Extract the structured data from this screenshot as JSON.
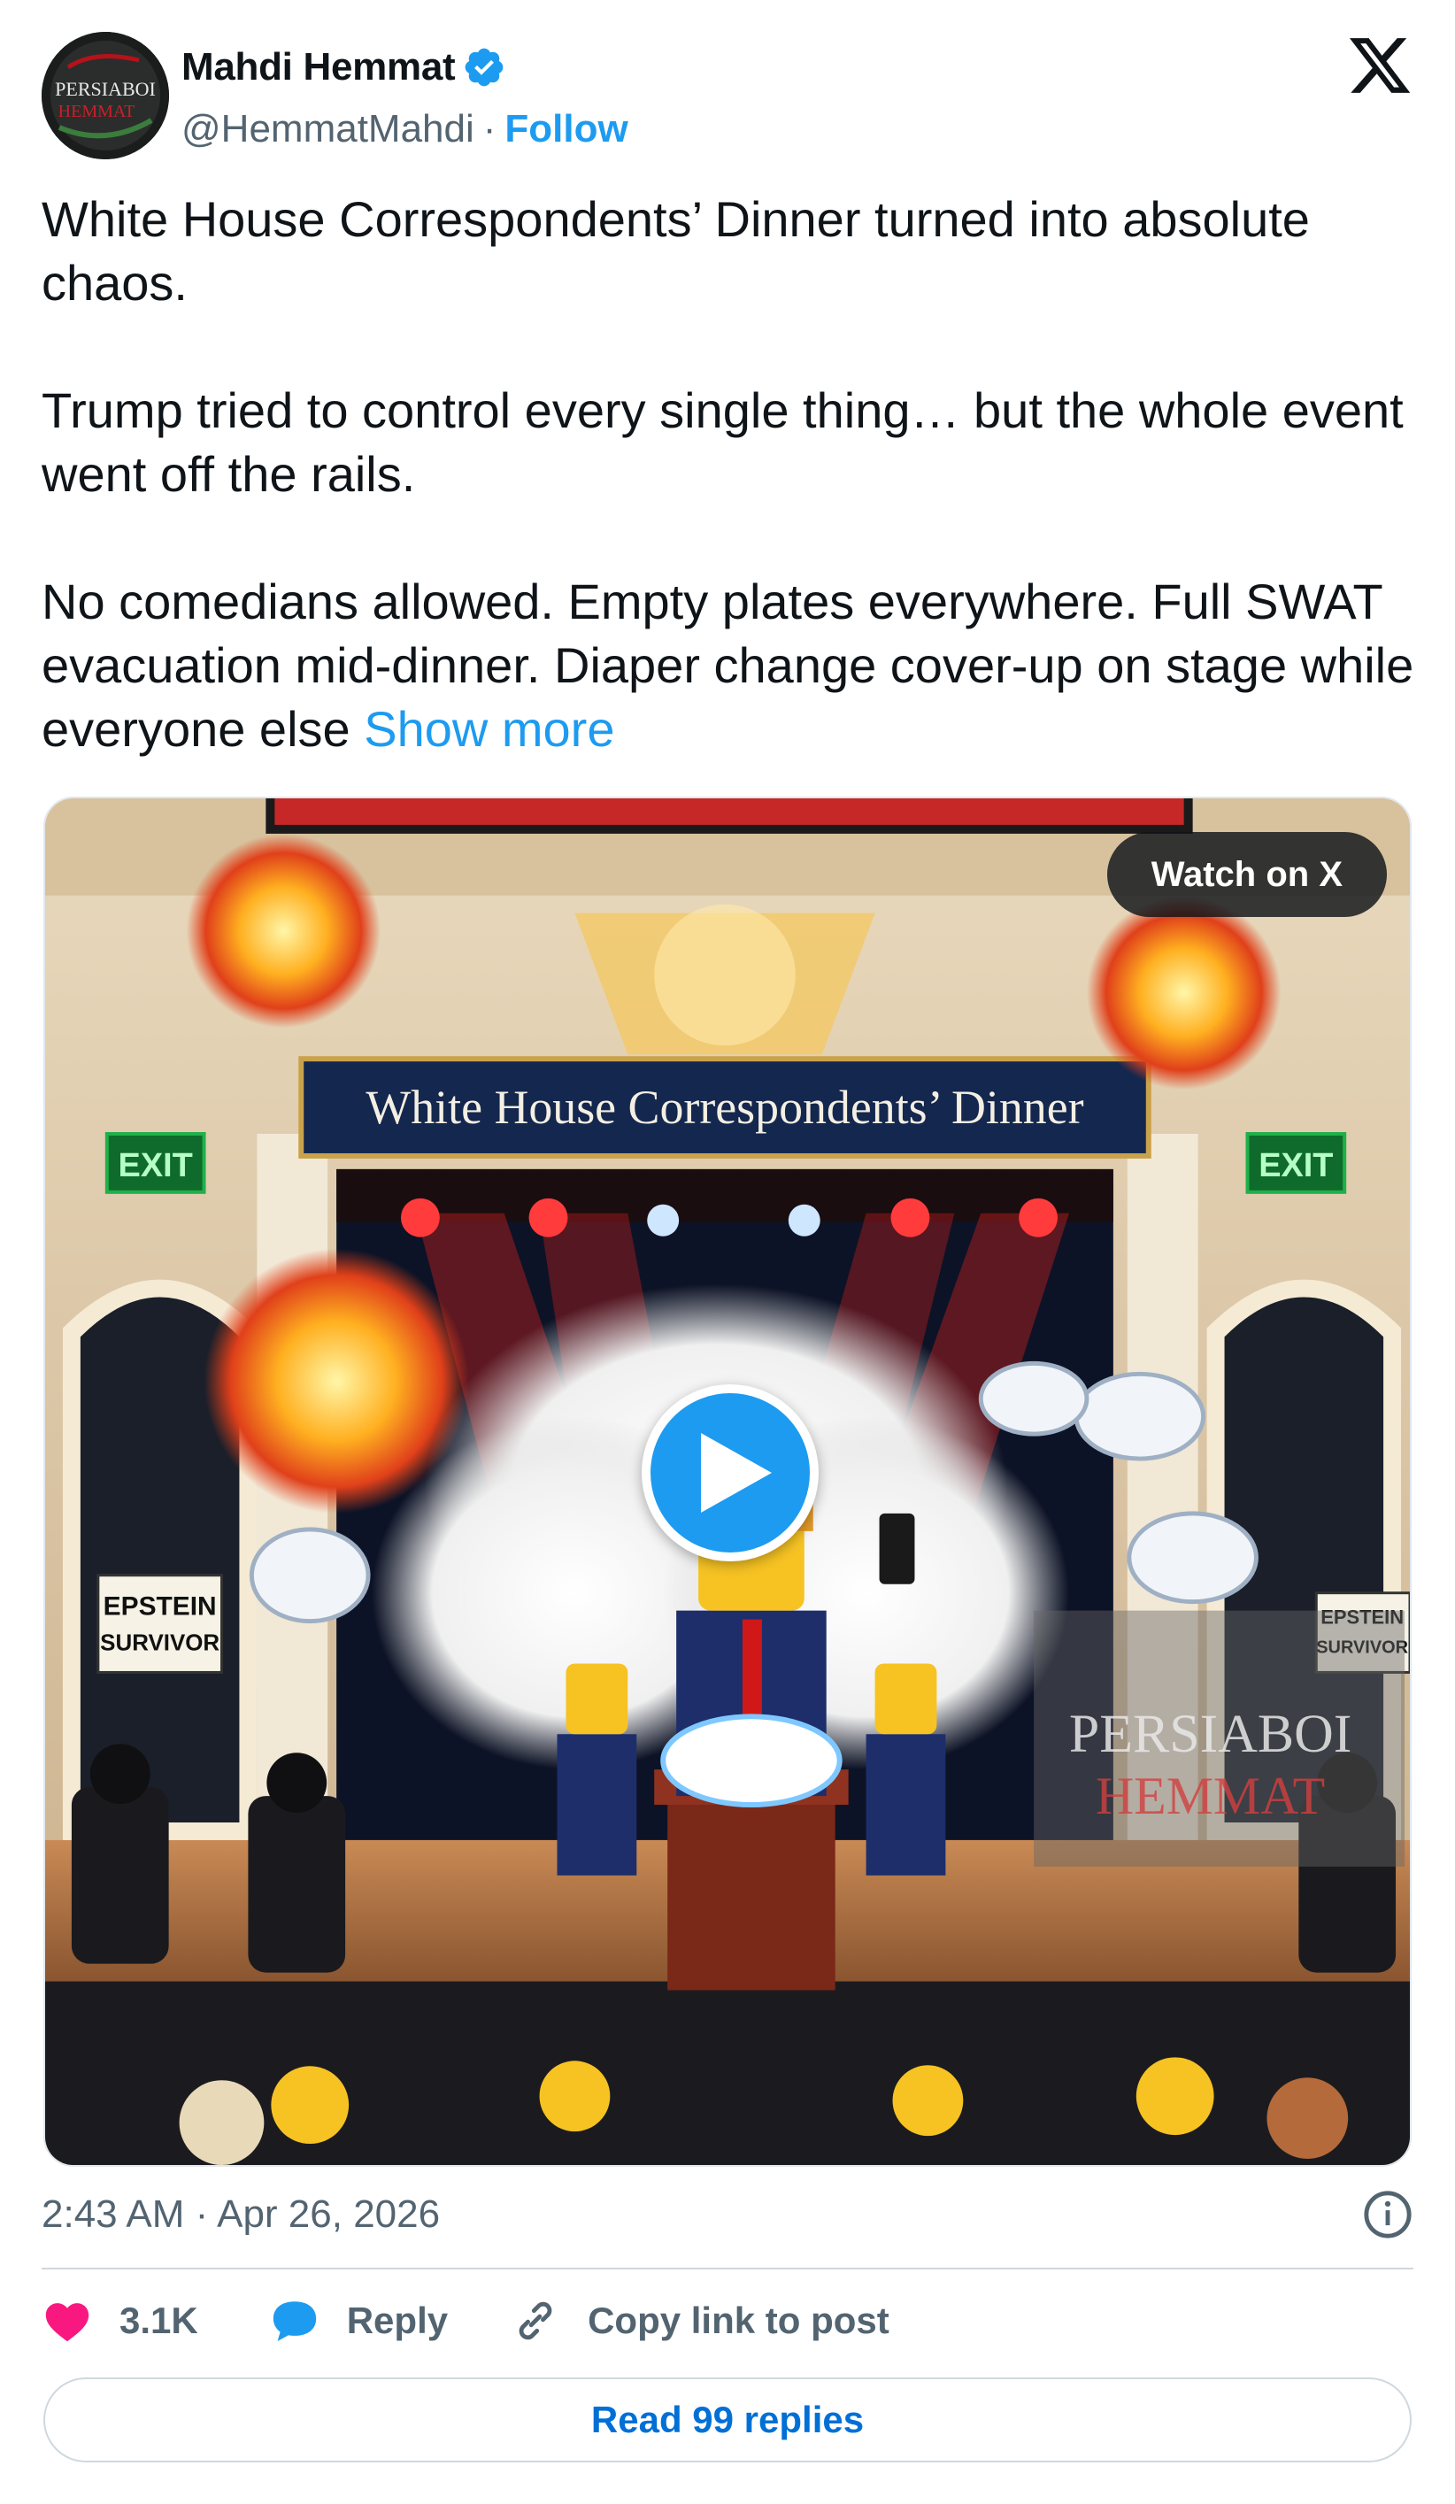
{
  "author": {
    "display_name": "Mahdi Hemmat",
    "handle": "@HemmatMahdi",
    "separator": "·",
    "follow_label": "Follow",
    "avatar_text_top": "PERSIABOI",
    "avatar_text_bottom": "HEMMAT",
    "verified": true
  },
  "tweet": {
    "paragraphs": [
      "White House Correspondents’ Dinner turned into absolute chaos.",
      "Trump tried to control every single thing… but the whole event went off the rails."
    ],
    "last_paragraph": "No comedians allowed. Empty plates everywhere. Full SWAT evacuation mid-dinner. Diaper change cover-up on stage while everyone else",
    "show_more_label": "Show more"
  },
  "media": {
    "watch_label": "Watch on X",
    "banner_text": "White House Correspondents’ Dinner",
    "exit_left": "EXIT",
    "exit_right": "EXIT",
    "sign_left_line1": "EPSTEIN",
    "sign_left_line2": "SURVIVOR",
    "sign_right_line1": "EPSTEIN",
    "sign_right_line2": "SURVIVOR",
    "watermark_top": "PERSIABOI",
    "watermark_bottom": "HEMMAT"
  },
  "meta": {
    "timestamp": "2:43 AM · Apr 26, 2026"
  },
  "actions": {
    "like_count": "3.1K",
    "reply_label": "Reply",
    "copy_label": "Copy link to post"
  },
  "footer": {
    "read_replies_label": "Read 99 replies"
  },
  "colors": {
    "accent": "#1d9bf0",
    "like": "#f91880",
    "text_secondary": "#536471"
  }
}
